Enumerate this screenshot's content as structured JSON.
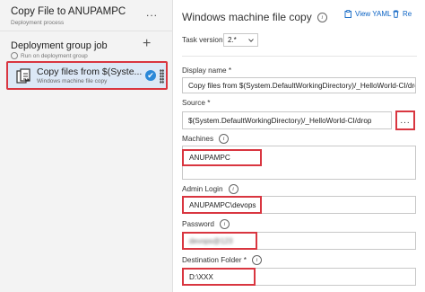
{
  "pipeline": {
    "title": "Copy File to ANUPAMPC",
    "subtitle": "Deployment process",
    "more_label": "..."
  },
  "job": {
    "title": "Deployment group job",
    "subtitle": "Run on deployment group",
    "add_label": "+"
  },
  "task": {
    "title": "Copy files from $(Syste...",
    "subtitle": "Windows machine file copy",
    "check": "✔"
  },
  "detail": {
    "title": "Windows machine file copy",
    "view_yaml": "View YAML",
    "remove": "Re",
    "task_version_label": "Task version",
    "task_version_value": "2.*",
    "display_name_label": "Display name *",
    "display_name_value": "Copy files from $(System.DefaultWorkingDirectory)/_HelloWorld-CI/drop",
    "source_label": "Source *",
    "source_value": "$(System.DefaultWorkingDirectory)/_HelloWorld-CI/drop",
    "browse_label": "...",
    "machines_label": "Machines",
    "machines_value": "ANUPAMPC",
    "admin_label": "Admin Login",
    "admin_value": "ANUPAMPC\\devops",
    "password_label": "Password",
    "password_value": "devops@123",
    "dest_label": "Destination Folder *",
    "dest_value": "D:\\XXX",
    "info_glyph": "i"
  },
  "colors": {
    "accent": "#0b63c4",
    "highlight": "#d93640",
    "selected_bg": "#dce8f6",
    "pane_bg": "#f3f3f3"
  }
}
